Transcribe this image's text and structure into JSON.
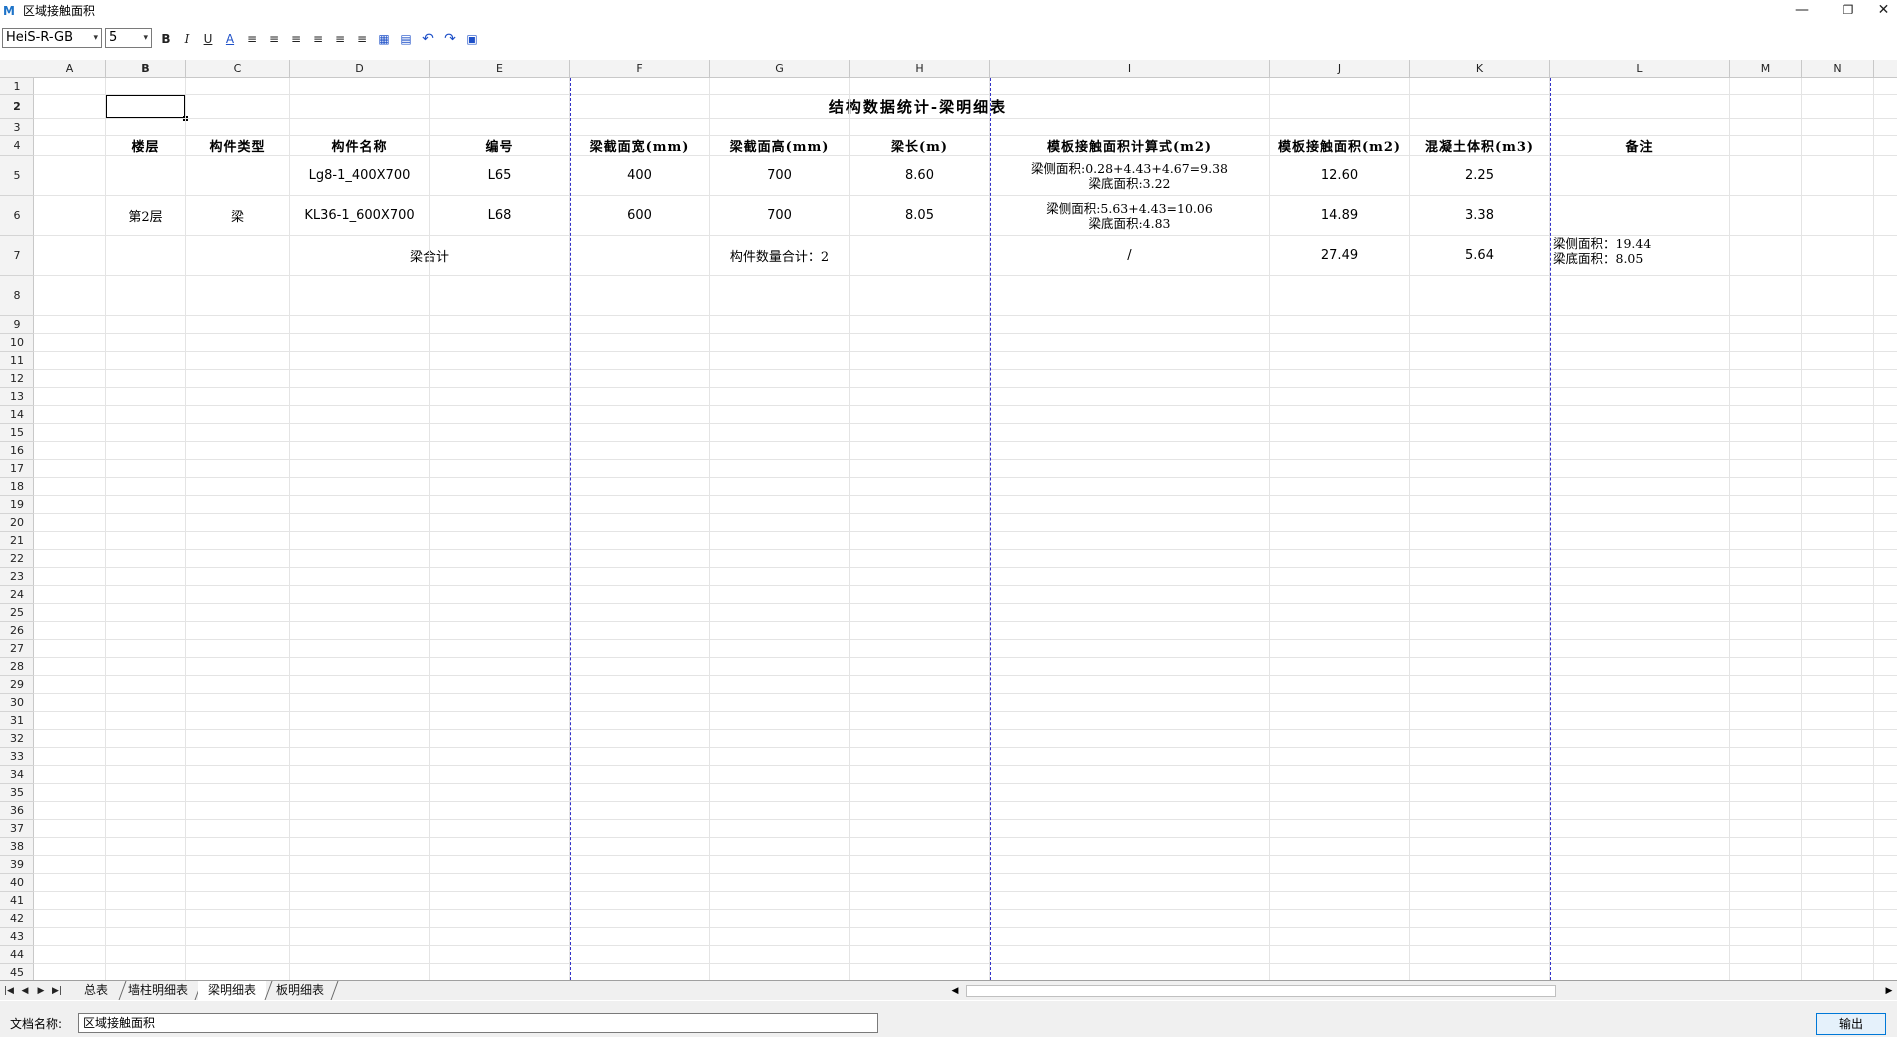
{
  "window": {
    "title": "区域接触面积",
    "icon": "M",
    "min_glyph": "—",
    "max_glyph": "❐",
    "close_glyph": "✕"
  },
  "toolbar": {
    "font": "HeiS-R-GB",
    "size": "5",
    "bold": "B",
    "italic": "I",
    "underline": "U",
    "fill_color_glyph": "A",
    "align_left_glyph": "≡",
    "align_center_glyph": "≡",
    "align_right_glyph": "≡",
    "valign_top_glyph": "≡",
    "valign_middle_glyph": "≡",
    "valign_bottom_glyph": "≡",
    "border_glyph": "▦",
    "merge_glyph": "▤",
    "undo_glyph": "↶",
    "redo_glyph": "↷",
    "save_glyph": "▣",
    "caret": "▾"
  },
  "columns": [
    "A",
    "B",
    "C",
    "D",
    "E",
    "F",
    "G",
    "H",
    "I",
    "J",
    "K",
    "L",
    "M",
    "N"
  ],
  "rows": [
    "1",
    "2",
    "3",
    "4",
    "5",
    "6",
    "7",
    "8",
    "9",
    "10",
    "11",
    "12",
    "13",
    "14",
    "15",
    "16",
    "17",
    "18",
    "19",
    "20",
    "21",
    "22",
    "23",
    "24",
    "25",
    "26",
    "27",
    "28",
    "29",
    "30",
    "31",
    "32",
    "33",
    "34",
    "35",
    "36",
    "37",
    "38",
    "39",
    "40",
    "41",
    "42",
    "43",
    "44",
    "45"
  ],
  "sheet": {
    "title": "结构数据统计-梁明细表",
    "headers": [
      "楼层",
      "构件类型",
      "构件名称",
      "编号",
      "梁截面宽(mm)",
      "梁截面高(mm)",
      "梁长(m)",
      "模板接触面积计算式(m2)",
      "模板接触面积(m2)",
      "混凝土体积(m3)",
      "备注"
    ],
    "floor": "第2层",
    "type": "梁",
    "rows": [
      {
        "name": "Lg8-1_400X700",
        "code": "L65",
        "width": "400",
        "height": "700",
        "length": "8.60",
        "formula_1": "梁侧面积:0.28+4.43+4.67=9.38",
        "formula_2": "梁底面积:3.22",
        "area": "12.60",
        "volume": "2.25",
        "note": ""
      },
      {
        "name": "KL36-1_600X700",
        "code": "L68",
        "width": "600",
        "height": "700",
        "length": "8.05",
        "formula_1": "梁侧面积:5.63+4.43=10.06",
        "formula_2": "梁底面积:4.83",
        "area": "14.89",
        "volume": "3.38",
        "note": ""
      }
    ],
    "total": {
      "label": "梁合计",
      "count": "构件数量合计：2",
      "formula": "/",
      "area": "27.49",
      "volume": "5.64",
      "note_1": "梁侧面积：19.44",
      "note_2": "梁底面积：8.05"
    }
  },
  "tabs": {
    "nav_first": "|◀",
    "nav_prev": "◀",
    "nav_next": "▶",
    "nav_last": "▶|",
    "items": [
      "总表",
      "墙柱明细表",
      "梁明细表",
      "板明细表"
    ],
    "active": "梁明细表",
    "scroll_left": "◀",
    "scroll_right": "▶"
  },
  "bottom": {
    "docname_label": "文档名称:",
    "docname_value": "区域接触面积",
    "export_label": "输出"
  }
}
